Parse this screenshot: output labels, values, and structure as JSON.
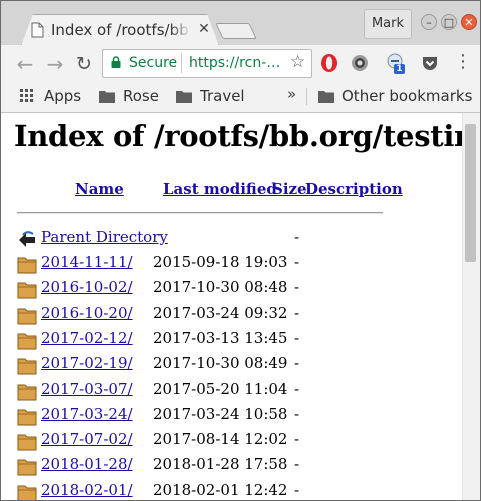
{
  "tab": {
    "title": "Index of /rootfs/bb.org/testing",
    "close": "✕"
  },
  "window": {
    "profile": "Mark",
    "min": "–",
    "max": "□",
    "close": "✕"
  },
  "toolbar": {
    "back": "←",
    "forward": "→",
    "reload": "↻",
    "secure_label": "Secure",
    "url": "https://rcn-…",
    "star": "☆",
    "badge_count": "1",
    "menu": "⋮"
  },
  "bookmarks": {
    "items": [
      {
        "label": "Apps",
        "icon": "apps-grid-icon"
      },
      {
        "label": "Rose",
        "icon": "folder-icon"
      },
      {
        "label": "Travel",
        "icon": "folder-icon"
      }
    ],
    "overflow": "»",
    "other": "Other bookmarks"
  },
  "page": {
    "heading": "Index of /rootfs/bb.org/testing",
    "columns": {
      "name": "Name",
      "modified": "Last modified",
      "size": "Size",
      "description": "Description"
    },
    "parent": {
      "name": "Parent Directory",
      "modified": "",
      "size": "-"
    },
    "rows": [
      {
        "name": "2014-11-11/",
        "modified": "2015-09-18 19:03",
        "size": "-"
      },
      {
        "name": "2016-10-02/",
        "modified": "2017-10-30 08:48",
        "size": "-"
      },
      {
        "name": "2016-10-20/",
        "modified": "2017-03-24 09:32",
        "size": "-"
      },
      {
        "name": "2017-02-12/",
        "modified": "2017-03-13 13:45",
        "size": "-"
      },
      {
        "name": "2017-02-19/",
        "modified": "2017-10-30 08:49",
        "size": "-"
      },
      {
        "name": "2017-03-07/",
        "modified": "2017-05-20 11:04",
        "size": "-"
      },
      {
        "name": "2017-03-24/",
        "modified": "2017-03-24 10:58",
        "size": "-"
      },
      {
        "name": "2017-07-02/",
        "modified": "2017-08-14 12:02",
        "size": "-"
      },
      {
        "name": "2018-01-28/",
        "modified": "2018-01-28 17:58",
        "size": "-"
      },
      {
        "name": "2018-02-01/",
        "modified": "2018-02-01 12:42",
        "size": "-"
      }
    ]
  },
  "colors": {
    "link": "#1a0dab",
    "secure": "#0b8043",
    "close_button": "#e8603c",
    "folder": "#d9a14a"
  }
}
